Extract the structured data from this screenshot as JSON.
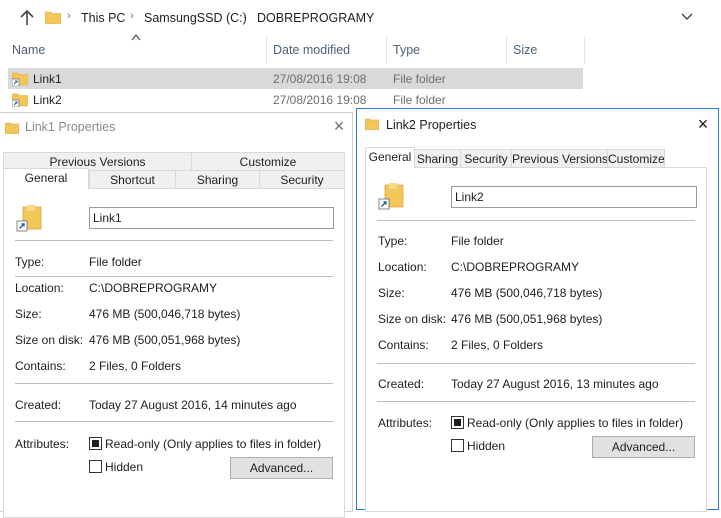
{
  "explorer": {
    "breadcrumbs": [
      "This PC",
      "SamsungSSD (C:)",
      "DOBREPROGRAMY"
    ],
    "columns": [
      "Name",
      "Date modified",
      "Type",
      "Size"
    ],
    "files": [
      {
        "name": "Link1",
        "date": "27/08/2016 19:08",
        "type": "File folder",
        "selected": true
      },
      {
        "name": "Link2",
        "date": "27/08/2016 19:08",
        "type": "File folder",
        "selected": false
      }
    ]
  },
  "dialog1": {
    "title": "Link1 Properties",
    "tabs_top": [
      "Previous Versions",
      "Customize"
    ],
    "tabs_bottom": [
      "General",
      "Shortcut",
      "Sharing",
      "Security"
    ],
    "name_value": "Link1",
    "labels": {
      "type": "Type:",
      "location": "Location:",
      "size": "Size:",
      "size_on_disk": "Size on disk:",
      "contains": "Contains:",
      "created": "Created:",
      "attributes": "Attributes:"
    },
    "values": {
      "type": "File folder",
      "location": "C:\\DOBREPROGRAMY",
      "size": "476 MB (500,046,718 bytes)",
      "size_on_disk": "476 MB (500,051,968 bytes)",
      "contains": "2 Files, 0 Folders",
      "created": "Today 27 August 2016, 14 minutes ago"
    },
    "readonly_label": "Read-only (Only applies to files in folder)",
    "hidden_label": "Hidden",
    "advanced_label": "Advanced..."
  },
  "dialog2": {
    "title": "Link2 Properties",
    "tabs": [
      "General",
      "Sharing",
      "Security",
      "Previous Versions",
      "Customize"
    ],
    "name_value": "Link2",
    "labels": {
      "type": "Type:",
      "location": "Location:",
      "size": "Size:",
      "size_on_disk": "Size on disk:",
      "contains": "Contains:",
      "created": "Created:",
      "attributes": "Attributes:"
    },
    "values": {
      "type": "File folder",
      "location": "C:\\DOBREPROGRAMY",
      "size": "476 MB (500,046,718 bytes)",
      "size_on_disk": "476 MB (500,051,968 bytes)",
      "contains": "2 Files, 0 Folders",
      "created": "Today 27 August 2016, 13 minutes ago"
    },
    "readonly_label": "Read-only (Only applies to files in folder)",
    "hidden_label": "Hidden",
    "advanced_label": "Advanced..."
  },
  "colors": {
    "accent_border": "#2b7ad8",
    "folder": "#f3c65a",
    "selection": "#d9d9d9",
    "header_text": "#4c607a"
  }
}
